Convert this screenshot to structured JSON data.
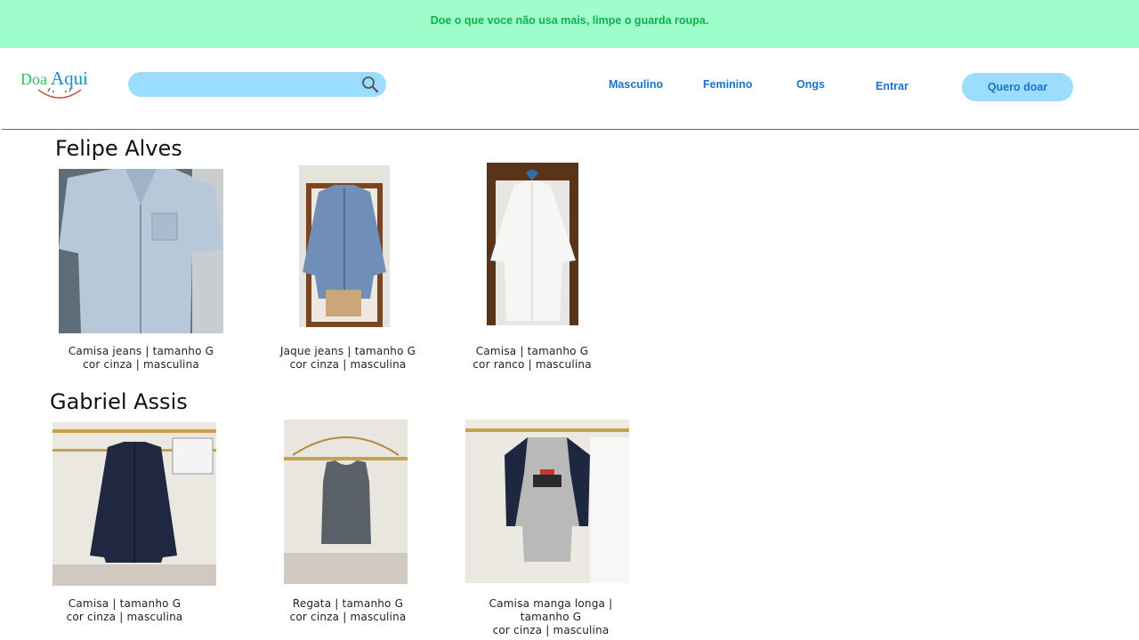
{
  "banner": {
    "text": "Doe o que voce não usa mais, limpe o guarda roupa."
  },
  "logo": {
    "doa": "Doa",
    "aqui": "Aqui"
  },
  "nav": {
    "masculino": "Masculino",
    "feminino": "Feminino",
    "ongs": "Ongs",
    "entrar": "Entrar",
    "cta": "Quero doar"
  },
  "donors": [
    {
      "name": "Felipe Alves",
      "items": [
        {
          "line1": "Camisa jeans | tamanho G",
          "line2": "cor cinza | masculina"
        },
        {
          "line1": "Jaque jeans | tamanho G",
          "line2": "cor cinza | masculina"
        },
        {
          "line1": "Camisa  | tamanho G",
          "line2": "cor ranco | masculina"
        }
      ]
    },
    {
      "name": "Gabriel Assis",
      "items": [
        {
          "line1": "Camisa  | tamanho G",
          "line2": "cor cinza | masculina"
        },
        {
          "line1": "Regata  | tamanho G",
          "line2": "cor cinza | masculina"
        },
        {
          "line1": "Camisa manga longa  |",
          "line2": "tamanho G",
          "line3": "cor cinza | masculina"
        }
      ]
    }
  ]
}
